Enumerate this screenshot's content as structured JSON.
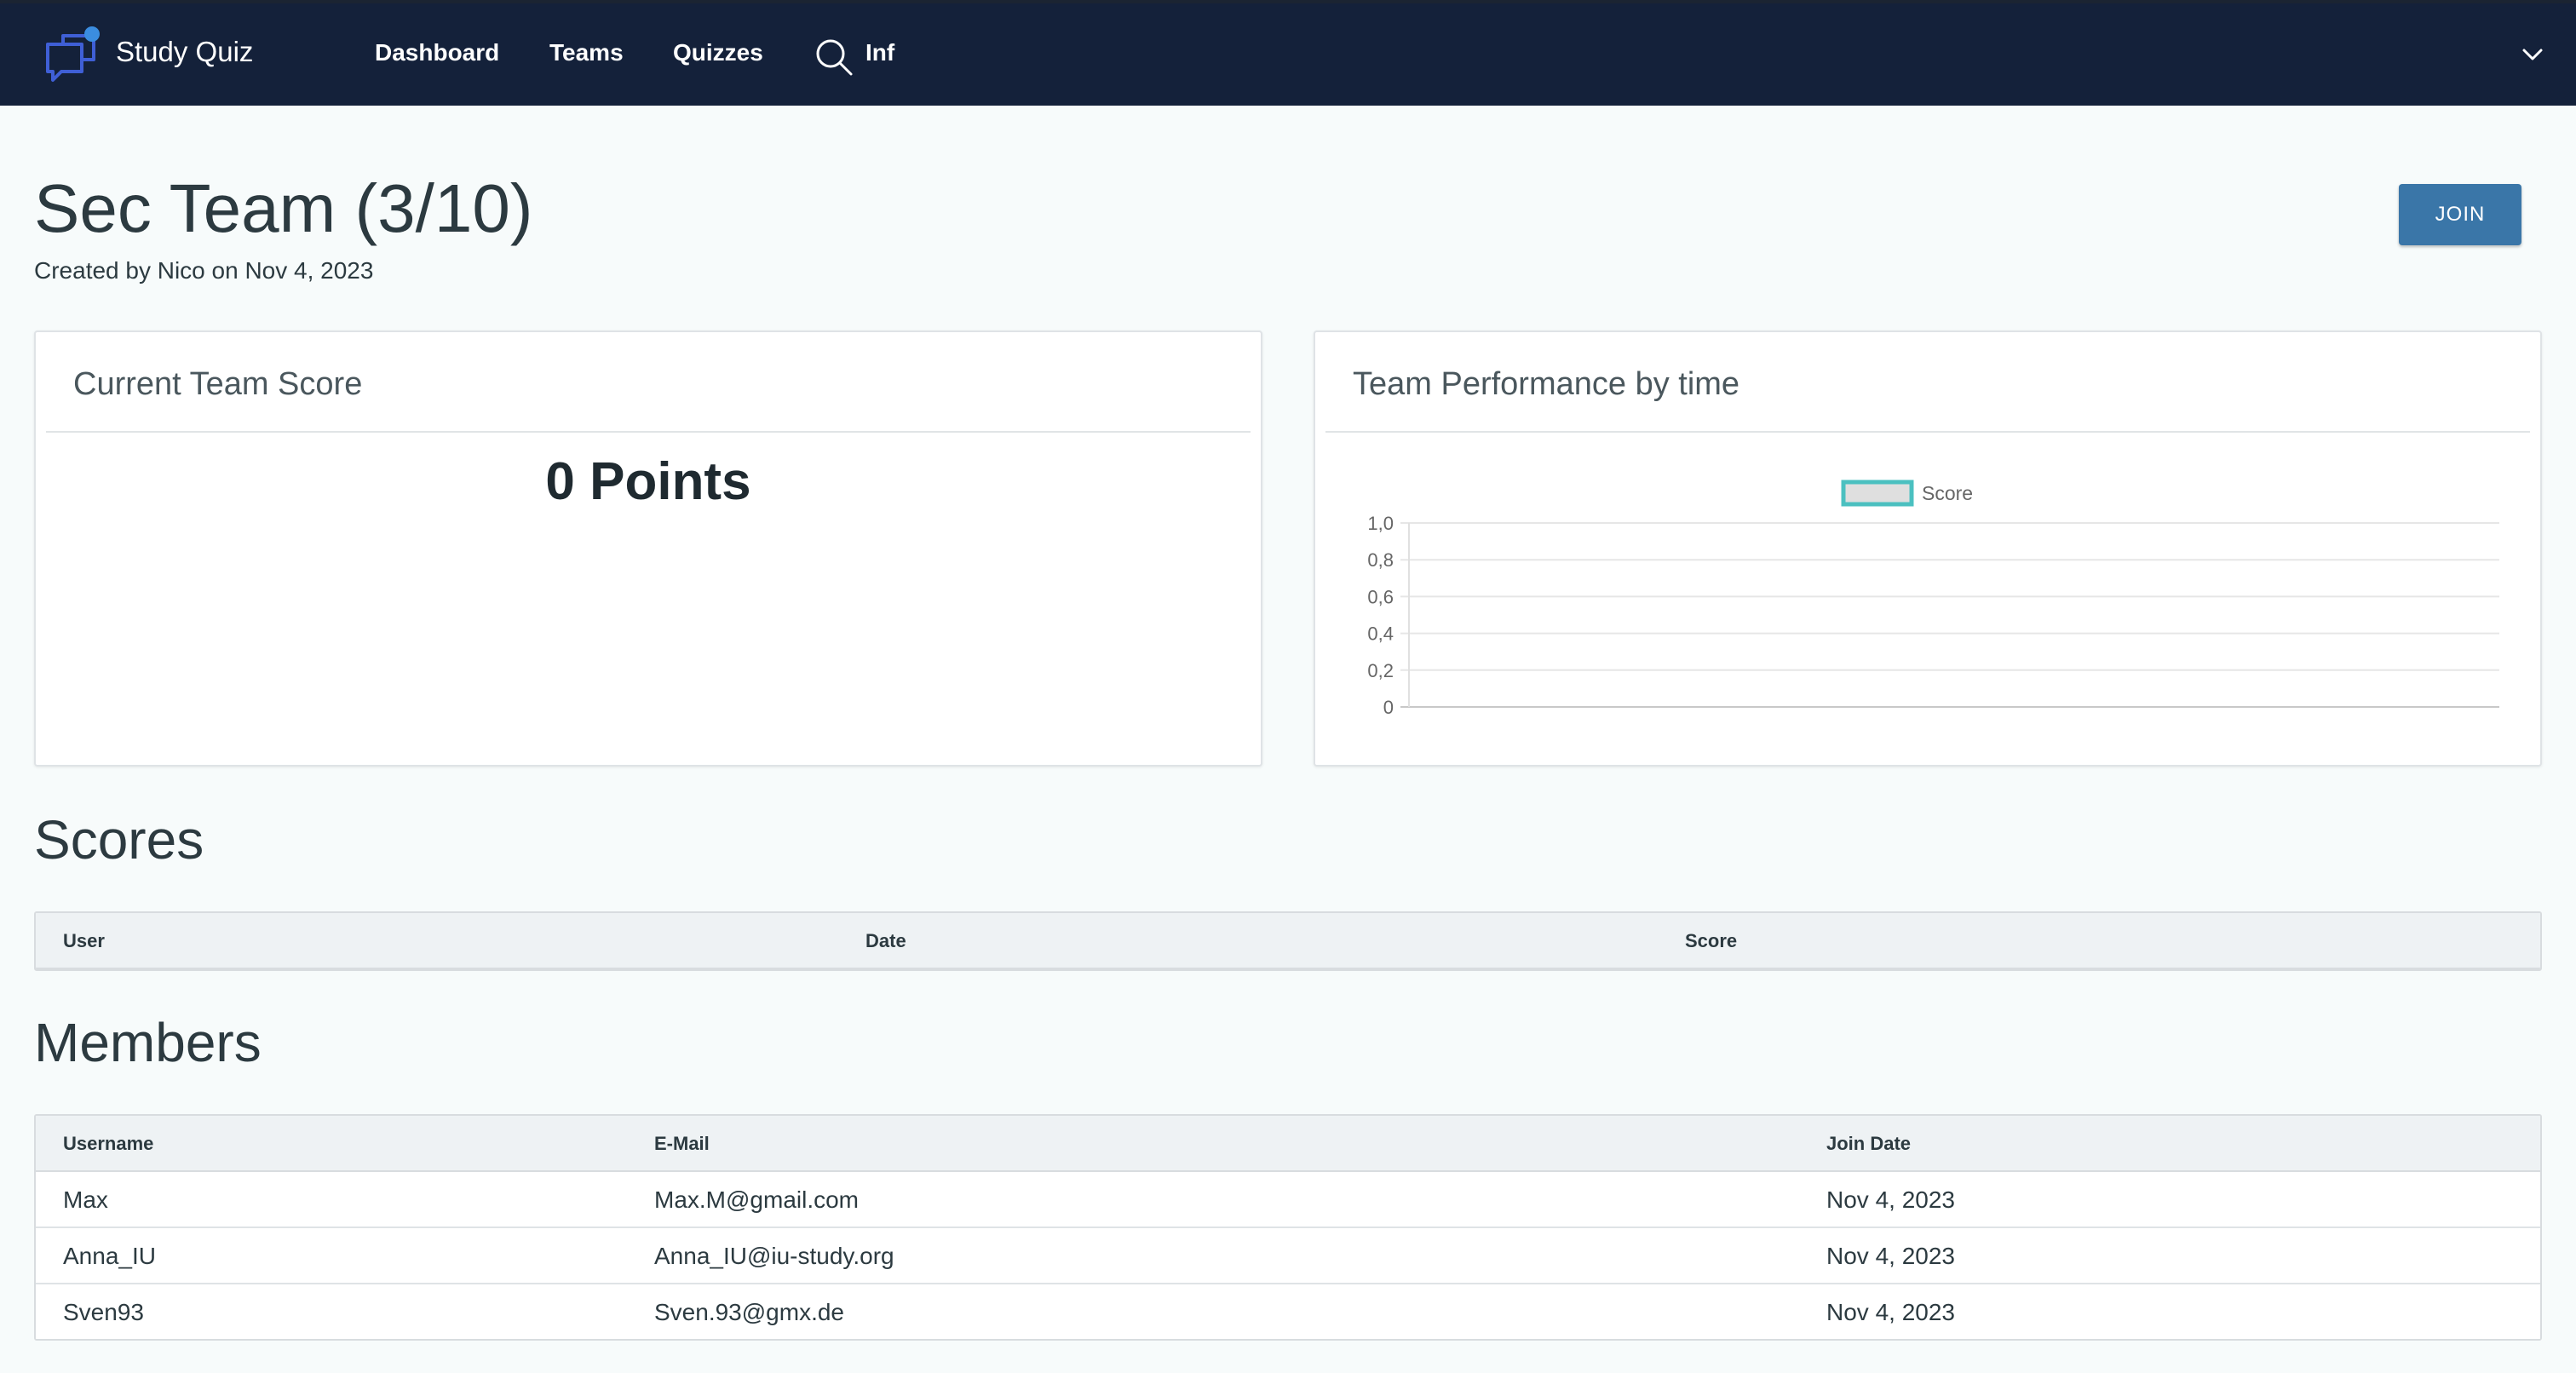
{
  "nav": {
    "brand": "Study Quiz",
    "links": [
      "Dashboard",
      "Teams",
      "Quizzes"
    ],
    "search_value": "Inf"
  },
  "team": {
    "title": "Sec Team (3/10)",
    "subtitle": "Created by Nico on Nov 4, 2023",
    "join_label": "JOIN"
  },
  "score_card": {
    "title": "Current Team Score",
    "points": "0 Points"
  },
  "perf_card": {
    "title": "Team Performance by time"
  },
  "chart_data": {
    "type": "line",
    "title": "",
    "xlabel": "",
    "ylabel": "",
    "series": [
      {
        "name": "Score",
        "values": []
      }
    ],
    "y_ticks": [
      "1,0",
      "0,8",
      "0,6",
      "0,4",
      "0,2",
      "0"
    ],
    "ylim": [
      0,
      1
    ],
    "grid": true,
    "legend_position": "top-center",
    "series_color": "#4bc0c0"
  },
  "scores": {
    "title": "Scores",
    "columns": [
      "User",
      "Date",
      "Score"
    ],
    "rows": []
  },
  "members": {
    "title": "Members",
    "columns": [
      "Username",
      "E-Mail",
      "Join Date"
    ],
    "rows": [
      {
        "username": "Max",
        "email": "Max.M@gmail.com",
        "join_date": "Nov 4, 2023"
      },
      {
        "username": "Anna_IU",
        "email": "Anna_IU@iu-study.org",
        "join_date": "Nov 4, 2023"
      },
      {
        "username": "Sven93",
        "email": "Sven.93@gmx.de",
        "join_date": "Nov 4, 2023"
      }
    ]
  },
  "colors": {
    "navbar": "#14213a",
    "accent_button": "#3a76a8",
    "logo": "#3f5fd6"
  }
}
